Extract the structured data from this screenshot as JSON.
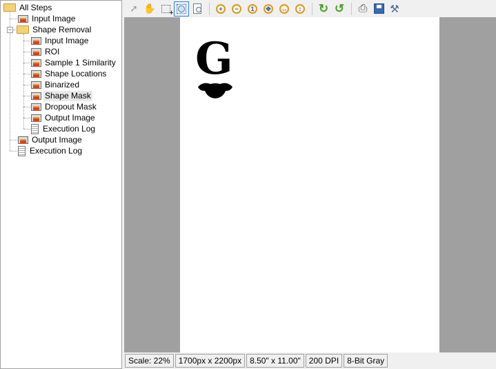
{
  "tree": {
    "root": "All Steps",
    "items": [
      {
        "label": "Input Image",
        "type": "image"
      },
      {
        "label": "Shape Removal",
        "type": "folder"
      },
      {
        "label": "Input Image",
        "type": "image"
      },
      {
        "label": "ROI",
        "type": "image"
      },
      {
        "label": "Sample 1 Similarity",
        "type": "image"
      },
      {
        "label": "Shape Locations",
        "type": "image"
      },
      {
        "label": "Binarized",
        "type": "image"
      },
      {
        "label": "Shape Mask",
        "type": "image",
        "selected": true
      },
      {
        "label": "Dropout Mask",
        "type": "image"
      },
      {
        "label": "Output Image",
        "type": "image"
      },
      {
        "label": "Execution Log",
        "type": "doc"
      },
      {
        "label": "Output Image",
        "type": "image"
      },
      {
        "label": "Execution Log",
        "type": "doc"
      }
    ]
  },
  "toolbar": [
    "select-pointer",
    "pan-hand",
    "region-select",
    "zoom-rect",
    "zoom-page",
    "zoom-in",
    "zoom-out",
    "zoom-actual",
    "zoom-fit",
    "zoom-width",
    "zoom-height",
    "rotate-right",
    "rotate-left",
    "print",
    "save",
    "settings"
  ],
  "canvas": {
    "glyph": "G"
  },
  "status": {
    "scale": "Scale: 22%",
    "pixels": "1700px x 2200px",
    "inches": "8.50\" x 11.00\"",
    "dpi": "200 DPI",
    "depth": "8-Bit Gray"
  }
}
